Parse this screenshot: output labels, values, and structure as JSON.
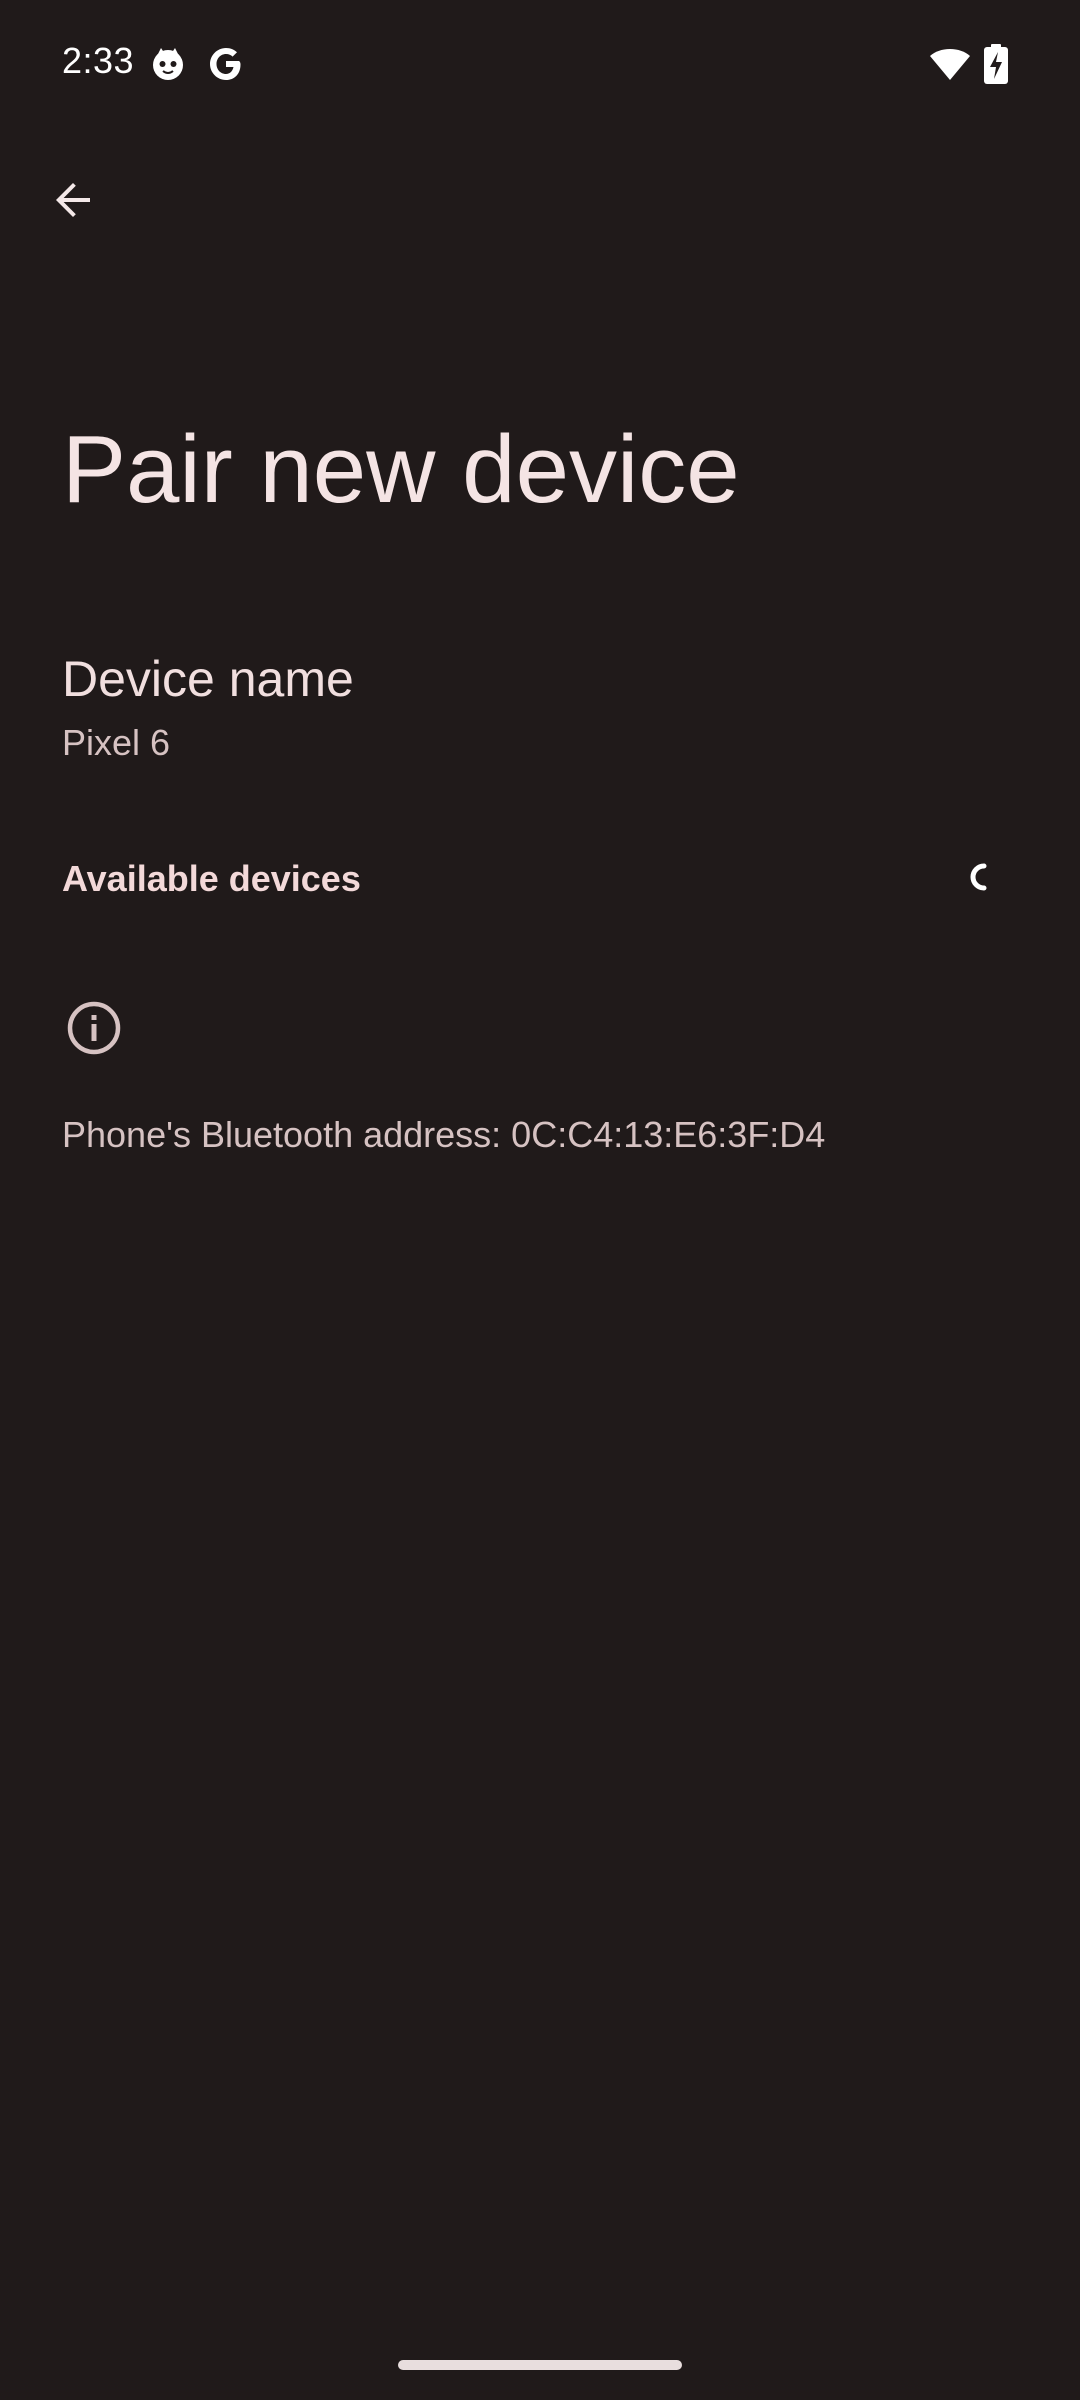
{
  "status_bar": {
    "time": "2:33",
    "left_icons": [
      "cat-notification-icon",
      "google-icon"
    ],
    "right_icons": [
      "wifi-icon",
      "battery-charging-icon"
    ]
  },
  "app_bar": {
    "back_icon": "arrow-back-icon"
  },
  "page": {
    "title": "Pair new device"
  },
  "device_name": {
    "title": "Device name",
    "value": "Pixel 6"
  },
  "available_devices": {
    "title": "Available devices",
    "loading_indicator": "progress-spinner"
  },
  "footer": {
    "icon": "info-icon",
    "text": "Phone's Bluetooth address: 0C:C4:13:E6:3F:D4"
  },
  "colors": {
    "background": "#201a1a",
    "text_primary": "#f1dfdf",
    "text_secondary": "#d6c2c2",
    "accent_header": "#f3d9d9"
  }
}
